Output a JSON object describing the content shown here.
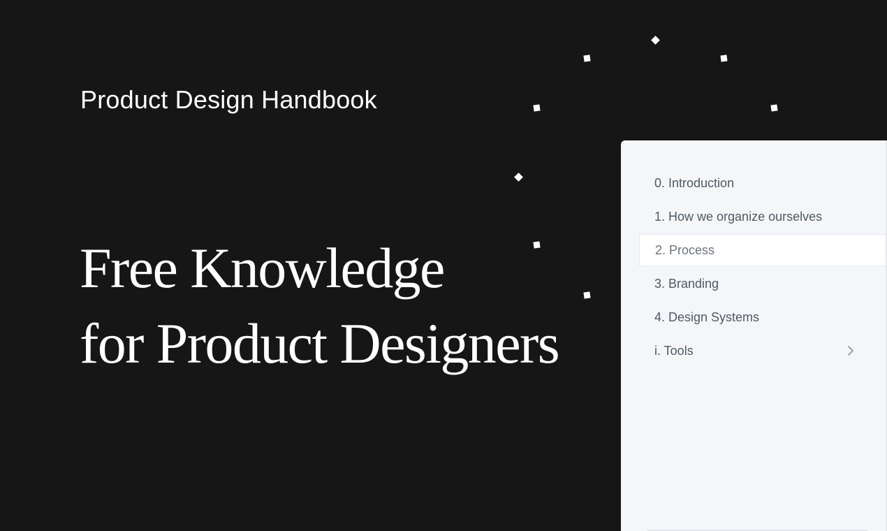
{
  "header": {
    "brand": "Product Design Handbook"
  },
  "hero": {
    "line1": "Free Knowledge",
    "line2": "for Product Designers"
  },
  "sidebar": {
    "items": [
      {
        "label": "0. Introduction"
      },
      {
        "label": "1. How we organize ourselves"
      },
      {
        "label": "2. Process",
        "active": true
      },
      {
        "label": "3. Branding"
      },
      {
        "label": "4. Design Systems"
      },
      {
        "label": "i. Tools",
        "icon": "chevron-right-icon"
      }
    ]
  },
  "colors": {
    "background": "#161616",
    "panel": "#f4f6f8",
    "nav_text": "#4e5a66",
    "active_bg": "#ffffff"
  }
}
